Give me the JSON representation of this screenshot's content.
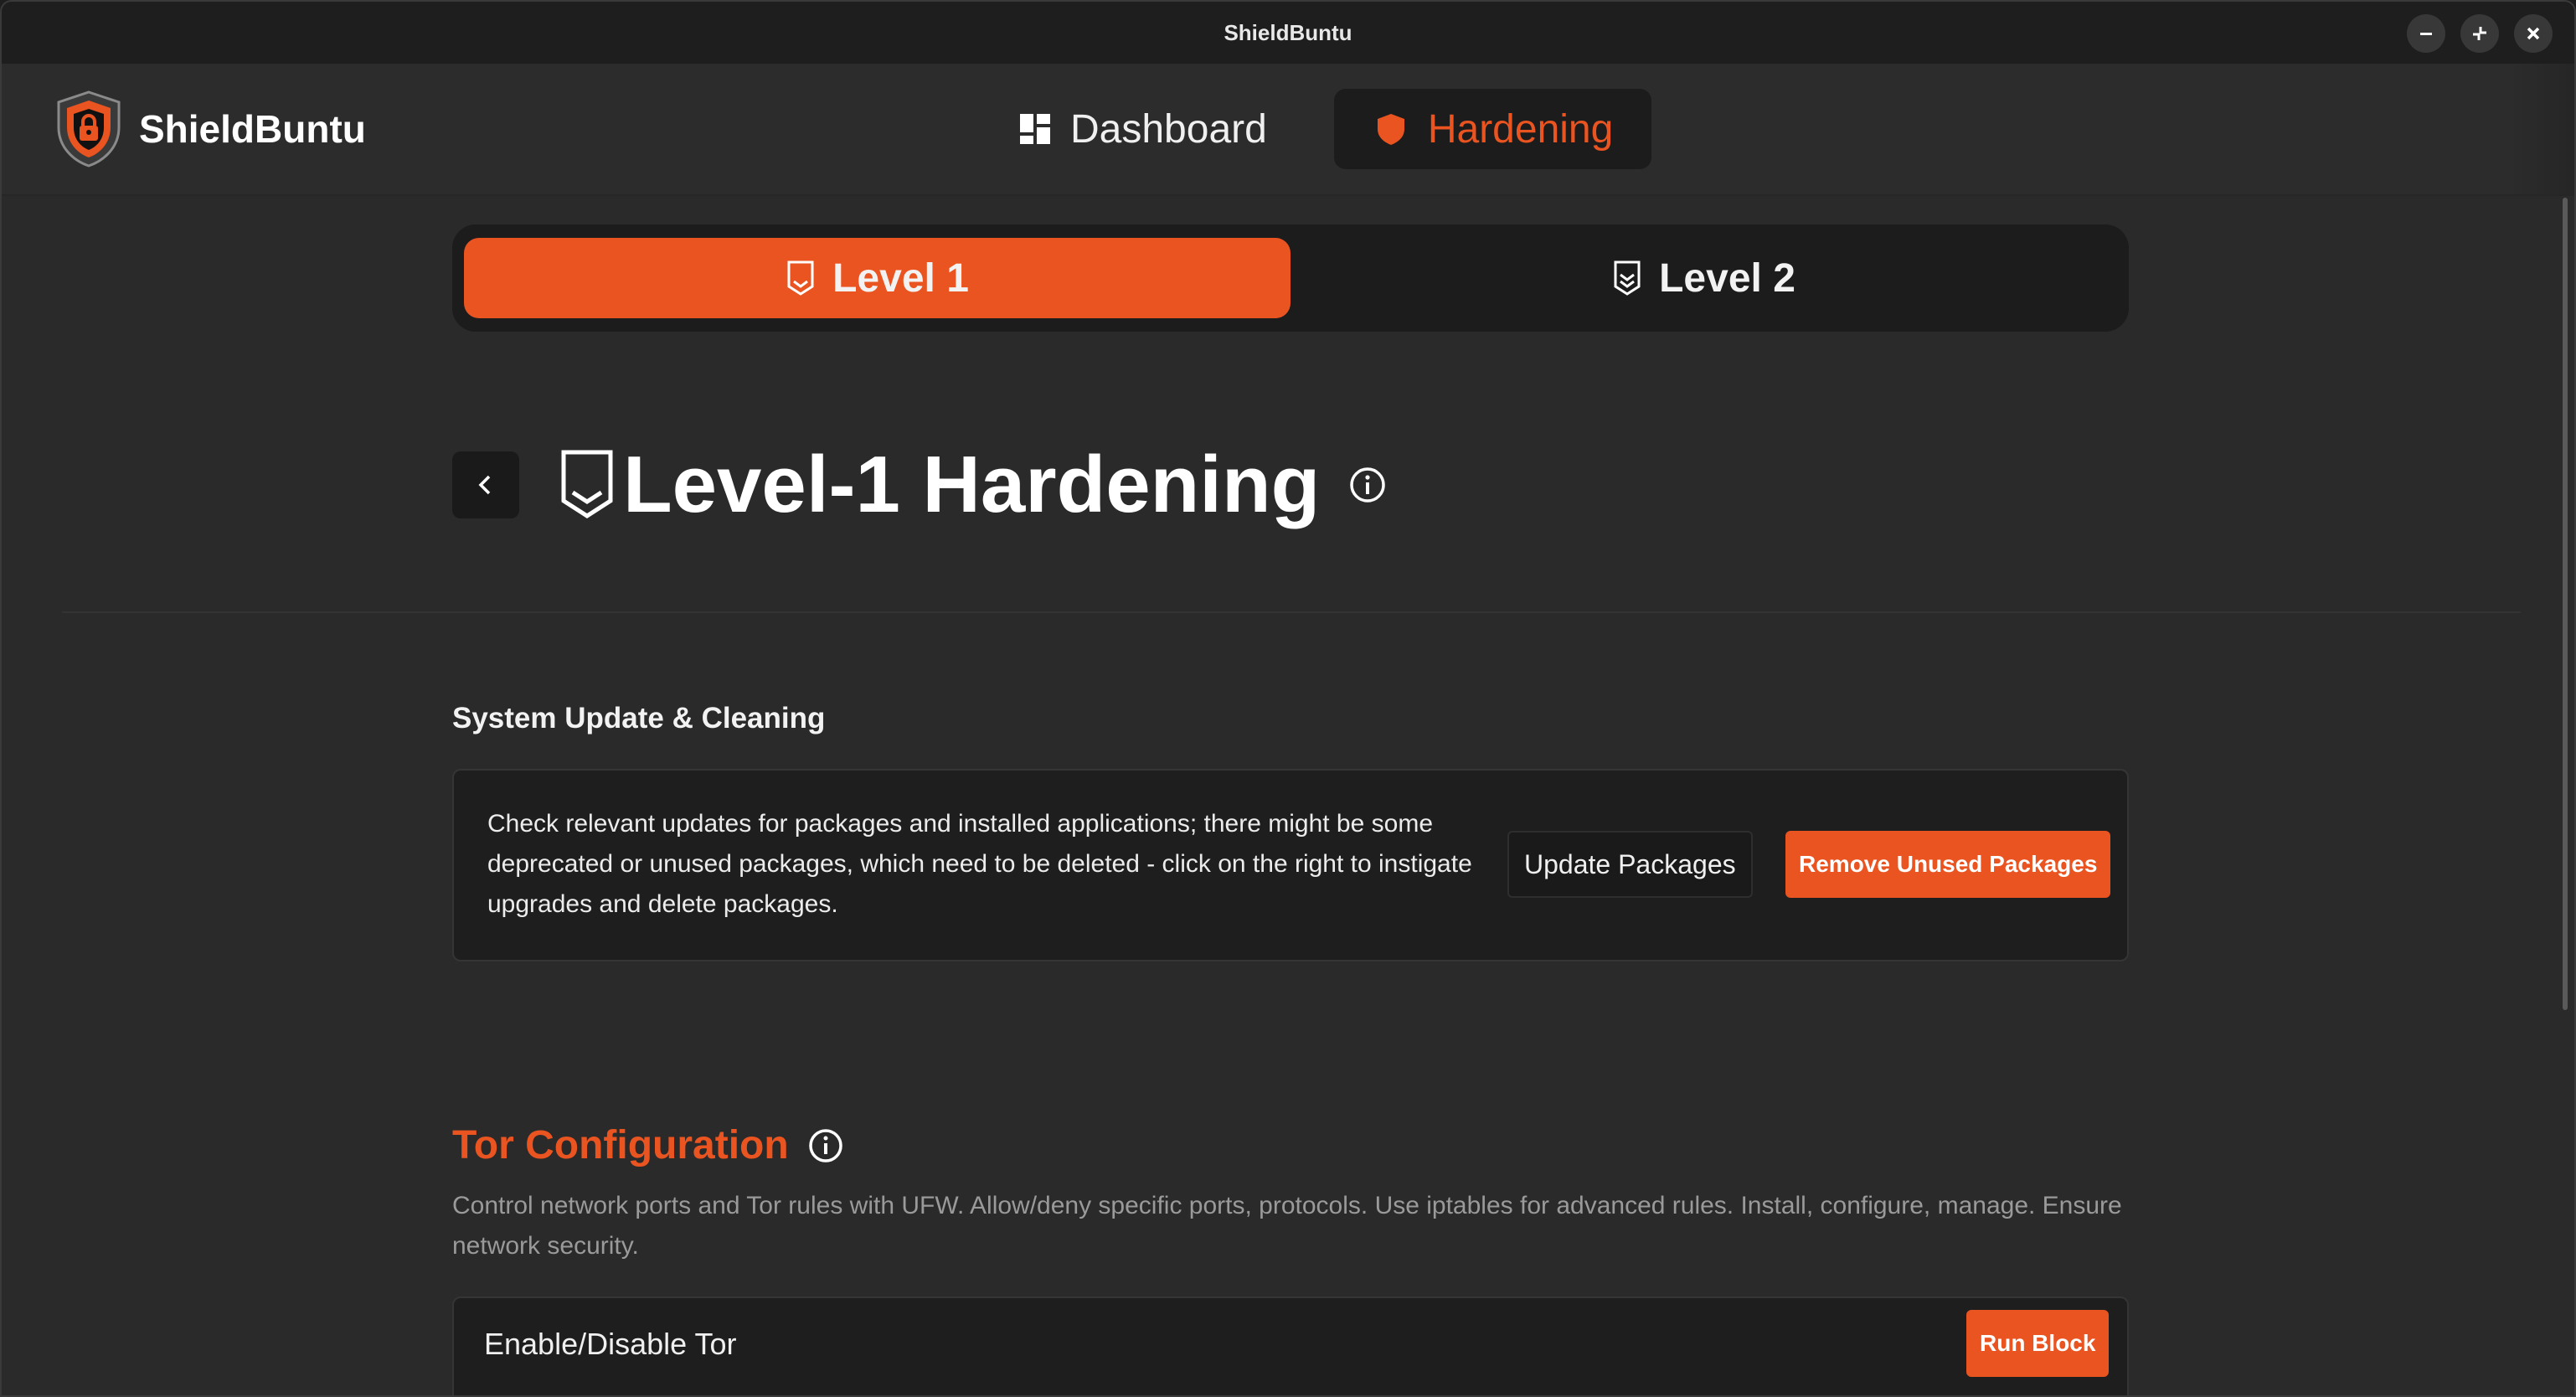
{
  "window": {
    "title": "ShieldBuntu"
  },
  "brand": {
    "name": "ShieldBuntu",
    "logo_icon": "shield-lock-icon"
  },
  "nav": {
    "items": [
      {
        "label": "Dashboard",
        "icon": "dashboard-icon",
        "active": false
      },
      {
        "label": "Hardening",
        "icon": "shield-icon",
        "active": true
      }
    ]
  },
  "level_tabs": [
    {
      "label": "Level 1",
      "icon": "shield-chevron-icon",
      "active": true
    },
    {
      "label": "Level 2",
      "icon": "shield-double-chevron-icon",
      "active": false
    }
  ],
  "page": {
    "title": "Level-1 Hardening"
  },
  "system_update": {
    "section_title": "System Update & Cleaning",
    "description": "Check relevant updates for packages and installed applications; there might be some deprecated or unused packages, which need to be deleted - click on the right to instigate upgrades and delete packages.",
    "update_button": "Update Packages",
    "remove_button": "Remove Unused Packages"
  },
  "tor": {
    "title": "Tor Configuration",
    "description": "Control network ports and Tor rules with UFW. Allow/deny specific ports, protocols. Use iptables for advanced rules. Install, configure, manage. Ensure network security.",
    "row_label": "Enable/Disable Tor",
    "run_button": "Run Block"
  },
  "colors": {
    "accent": "#e95420",
    "background": "#2a2a2a",
    "card": "#1e1e1e"
  }
}
